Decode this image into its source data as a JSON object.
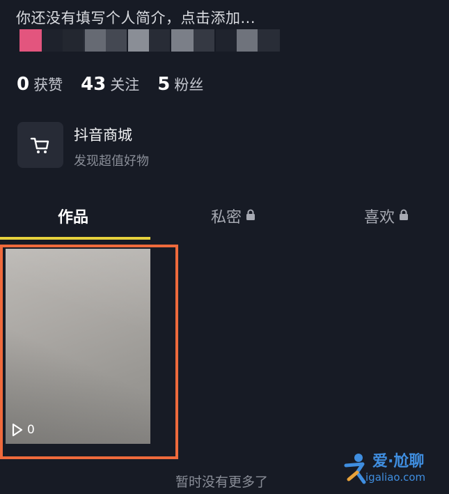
{
  "profile": {
    "bio_placeholder": "你还没有填写个人简介，点击添加..."
  },
  "stats": [
    {
      "value": "0",
      "label": "获赞"
    },
    {
      "value": "43",
      "label": "关注"
    },
    {
      "value": "5",
      "label": "粉丝"
    }
  ],
  "shop": {
    "title": "抖音商城",
    "subtitle": "发现超值好物",
    "icon": "shopping-cart-icon"
  },
  "tabs": [
    {
      "label": "作品",
      "active": true,
      "locked": false
    },
    {
      "label": "私密",
      "active": false,
      "locked": true
    },
    {
      "label": "喜欢",
      "active": false,
      "locked": true
    }
  ],
  "videos": [
    {
      "play_count": "0"
    }
  ],
  "footer_text": "暂时没有更多了",
  "watermark": {
    "text": "爱·尬聊",
    "url": "igaliao.com"
  },
  "colors": {
    "background": "#171b25",
    "tab_indicator": "#e6d23d",
    "highlight": "#ef6a3c",
    "watermark": "#3f8ee0"
  }
}
